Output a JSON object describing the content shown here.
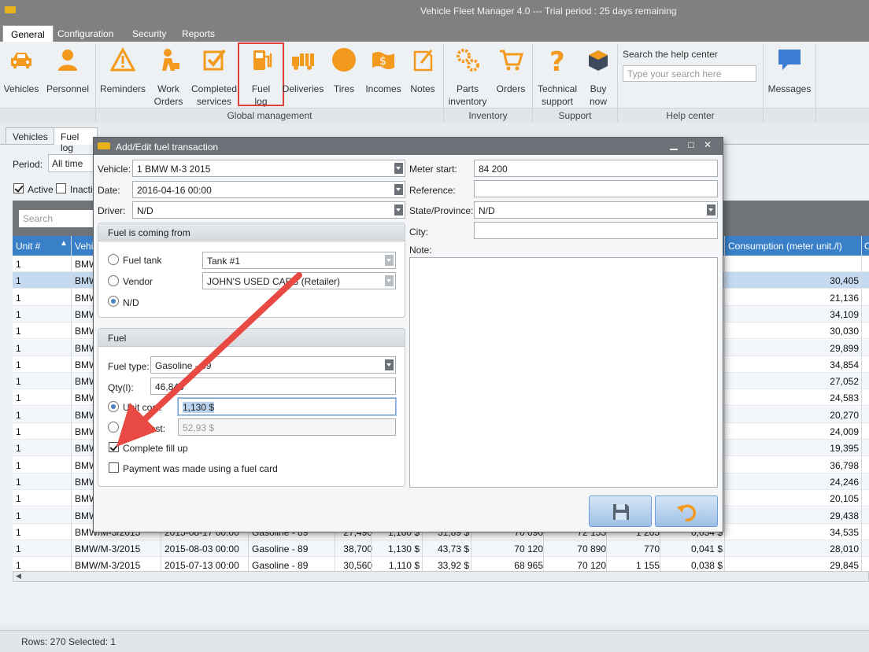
{
  "app": {
    "title": "Vehicle Fleet Manager 4.0 --- Trial period : 25 days remaining"
  },
  "menu_tabs": [
    "General",
    "Configuration",
    "Security",
    "Reports"
  ],
  "ribbon": {
    "buttons": [
      {
        "line1": "Vehicles",
        "line2": "",
        "icon": "car-icon"
      },
      {
        "line1": "Personnel",
        "line2": "",
        "icon": "person-icon"
      },
      {
        "line1": "Reminders",
        "line2": "",
        "icon": "warning-icon"
      },
      {
        "line1": "Work",
        "line2": "Orders",
        "icon": "worker-icon"
      },
      {
        "line1": "Completed",
        "line2": "services",
        "icon": "checkbox-icon"
      },
      {
        "line1": "Fuel",
        "line2": "log",
        "icon": "fuel-pump-icon"
      },
      {
        "line1": "Deliveries",
        "line2": "",
        "icon": "truck-icon"
      },
      {
        "line1": "Tires",
        "line2": "",
        "icon": "tire-icon"
      },
      {
        "line1": "Incomes",
        "line2": "",
        "icon": "money-icon"
      },
      {
        "line1": "Notes",
        "line2": "",
        "icon": "note-icon"
      },
      {
        "line1": "Parts",
        "line2": "inventory",
        "icon": "gears-icon"
      },
      {
        "line1": "Orders",
        "line2": "",
        "icon": "cart-icon"
      },
      {
        "line1": "Technical",
        "line2": "support",
        "icon": "question-icon"
      },
      {
        "line1": "Buy",
        "line2": "now",
        "icon": "box-icon"
      },
      {
        "line1": "Messages",
        "line2": "",
        "icon": "chat-icon"
      }
    ],
    "groups": [
      "Global management",
      "Inventory",
      "Support",
      "Help center"
    ],
    "help_title": "Search the help center",
    "help_placeholder": "Type your search here"
  },
  "doc_tabs": [
    "Vehicles",
    "Fuel log"
  ],
  "filters": {
    "period_label": "Period:",
    "period_value": "All time",
    "active_label": "Active",
    "inactive_label": "Inacti"
  },
  "grid": {
    "search_placeholder": "Search",
    "headers": {
      "unit": "Unit #",
      "vehicle": "Vehi",
      "consumption": "Consumption (meter unit./l)",
      "extra": "C"
    },
    "rows": [
      {
        "unit": "1",
        "vehicle": "BMW",
        "date": "",
        "fuel": "",
        "qty": "",
        "unit_cost": "",
        "total": "",
        "start": "",
        "end": "",
        "dist": "",
        "cost_per": "",
        "consumption": ""
      },
      {
        "unit": "1",
        "vehicle": "BMW",
        "date": "",
        "fuel": "",
        "qty": "",
        "unit_cost": "",
        "total": "",
        "start": "",
        "end": "",
        "dist": "",
        "cost_per": "",
        "consumption": "30,405"
      },
      {
        "unit": "1",
        "vehicle": "BMW",
        "date": "",
        "fuel": "",
        "qty": "",
        "unit_cost": "",
        "total": "",
        "start": "",
        "end": "",
        "dist": "",
        "cost_per": "",
        "consumption": "21,136"
      },
      {
        "unit": "1",
        "vehicle": "BMW",
        "date": "",
        "fuel": "",
        "qty": "",
        "unit_cost": "",
        "total": "",
        "start": "",
        "end": "",
        "dist": "",
        "cost_per": "",
        "consumption": "34,109"
      },
      {
        "unit": "1",
        "vehicle": "BMW",
        "date": "",
        "fuel": "",
        "qty": "",
        "unit_cost": "",
        "total": "",
        "start": "",
        "end": "",
        "dist": "",
        "cost_per": "",
        "consumption": "30,030"
      },
      {
        "unit": "1",
        "vehicle": "BMW",
        "date": "",
        "fuel": "",
        "qty": "",
        "unit_cost": "",
        "total": "",
        "start": "",
        "end": "",
        "dist": "",
        "cost_per": "",
        "consumption": "29,899"
      },
      {
        "unit": "1",
        "vehicle": "BMW",
        "date": "",
        "fuel": "",
        "qty": "",
        "unit_cost": "",
        "total": "",
        "start": "",
        "end": "",
        "dist": "",
        "cost_per": "",
        "consumption": "34,854"
      },
      {
        "unit": "1",
        "vehicle": "BMW",
        "date": "",
        "fuel": "",
        "qty": "",
        "unit_cost": "",
        "total": "",
        "start": "",
        "end": "",
        "dist": "",
        "cost_per": "",
        "consumption": "27,052"
      },
      {
        "unit": "1",
        "vehicle": "BMW",
        "date": "",
        "fuel": "",
        "qty": "",
        "unit_cost": "",
        "total": "",
        "start": "",
        "end": "",
        "dist": "",
        "cost_per": "",
        "consumption": "24,583"
      },
      {
        "unit": "1",
        "vehicle": "BMW",
        "date": "",
        "fuel": "",
        "qty": "",
        "unit_cost": "",
        "total": "",
        "start": "",
        "end": "",
        "dist": "",
        "cost_per": "",
        "consumption": "20,270"
      },
      {
        "unit": "1",
        "vehicle": "BMW",
        "date": "",
        "fuel": "",
        "qty": "",
        "unit_cost": "",
        "total": "",
        "start": "",
        "end": "",
        "dist": "",
        "cost_per": "",
        "consumption": "24,009"
      },
      {
        "unit": "1",
        "vehicle": "BMW",
        "date": "",
        "fuel": "",
        "qty": "",
        "unit_cost": "",
        "total": "",
        "start": "",
        "end": "",
        "dist": "",
        "cost_per": "",
        "consumption": "19,395"
      },
      {
        "unit": "1",
        "vehicle": "BMW",
        "date": "",
        "fuel": "",
        "qty": "",
        "unit_cost": "",
        "total": "",
        "start": "",
        "end": "",
        "dist": "",
        "cost_per": "",
        "consumption": "36,798"
      },
      {
        "unit": "1",
        "vehicle": "BMW",
        "date": "",
        "fuel": "",
        "qty": "",
        "unit_cost": "",
        "total": "",
        "start": "",
        "end": "",
        "dist": "",
        "cost_per": "",
        "consumption": "24,246"
      },
      {
        "unit": "1",
        "vehicle": "BMW",
        "date": "",
        "fuel": "",
        "qty": "",
        "unit_cost": "",
        "total": "",
        "start": "",
        "end": "",
        "dist": "",
        "cost_per": "",
        "consumption": "20,105"
      },
      {
        "unit": "1",
        "vehicle": "BMW",
        "date": "",
        "fuel": "",
        "qty": "",
        "unit_cost": "",
        "total": "",
        "start": "",
        "end": "",
        "dist": "",
        "cost_per": "",
        "consumption": "29,438"
      },
      {
        "unit": "1",
        "vehicle": "BMW/M-3/2015",
        "date": "2015-08-17 00:00",
        "fuel": "Gasoline - 89",
        "qty": "27,490",
        "unit_cost": "1,160 $",
        "total": "31,89 $",
        "start": "70 090",
        "end": "72 155",
        "dist": "1 265",
        "cost_per": "0,034 $",
        "consumption": "34,535"
      },
      {
        "unit": "1",
        "vehicle": "BMW/M-3/2015",
        "date": "2015-08-03 00:00",
        "fuel": "Gasoline - 89",
        "qty": "38,700",
        "unit_cost": "1,130 $",
        "total": "43,73 $",
        "start": "70 120",
        "end": "70 890",
        "dist": "770",
        "cost_per": "0,041 $",
        "consumption": "28,010"
      },
      {
        "unit": "1",
        "vehicle": "BMW/M-3/2015",
        "date": "2015-07-13 00:00",
        "fuel": "Gasoline - 89",
        "qty": "30,560",
        "unit_cost": "1,110 $",
        "total": "33,92 $",
        "start": "68 965",
        "end": "70 120",
        "dist": "1 155",
        "cost_per": "0,038 $",
        "consumption": "29,845"
      }
    ]
  },
  "status": {
    "text": "Rows: 270  Selected: 1"
  },
  "dialog": {
    "title": "Add/Edit fuel transaction",
    "vehicle_label": "Vehicle:",
    "vehicle_value": "1  BMW  M-3  2015",
    "date_label": "Date:",
    "date_value": "2016-04-16 00:00",
    "driver_label": "Driver:",
    "driver_value": "N/D",
    "meter_label": "Meter start:",
    "meter_value": "84 200",
    "reference_label": "Reference:",
    "reference_value": "",
    "state_label": "State/Province:",
    "state_value": "N/D",
    "city_label": "City:",
    "city_value": "",
    "note_label": "Note:",
    "source_panel": "Fuel is coming from",
    "fuel_tank_label": "Fuel tank",
    "fuel_tank_value": "Tank #1",
    "vendor_label": "Vendor",
    "vendor_value": "JOHN'S USED CARS (Retailer)",
    "nd_label": "N/D",
    "fuel_panel": "Fuel",
    "fuel_type_label": "Fuel type:",
    "fuel_type_value": "Gasoline - 89",
    "qty_label": "Qty(l):",
    "qty_value": "46,840",
    "unit_cost_label": "Unit cost:",
    "unit_cost_value": "1,130 $",
    "total_cost_label": "Total cost:",
    "total_cost_value": "52,93 $",
    "fill_label": "Complete fill up",
    "card_label": "Payment was made using a fuel card"
  }
}
